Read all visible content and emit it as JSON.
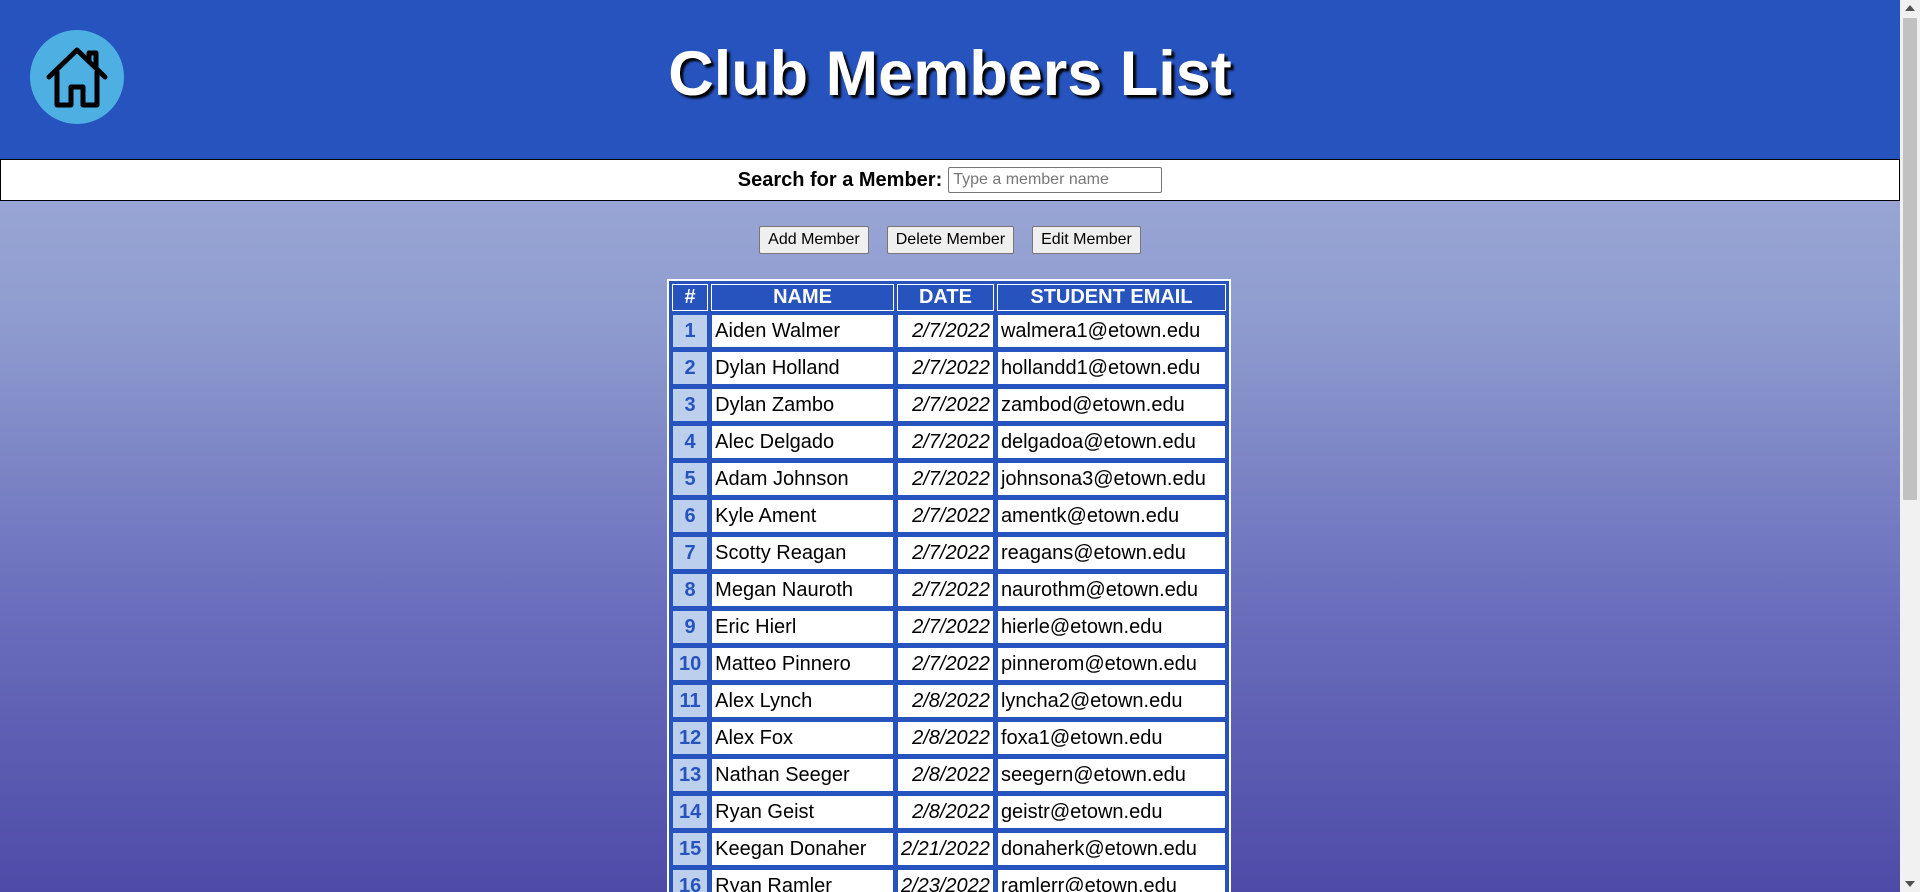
{
  "header": {
    "title": "Club Members List",
    "home_icon": "home-icon",
    "colors": {
      "header_bg": "#2653be",
      "home_button": "#4dafe2",
      "number_cell": "#bcd0ee"
    }
  },
  "search": {
    "label": "Search for a Member:",
    "placeholder": "Type a member name",
    "value": ""
  },
  "actions": {
    "add_label": "Add Member",
    "delete_label": "Delete Member",
    "edit_label": "Edit Member"
  },
  "table": {
    "headers": [
      "#",
      "NAME",
      "DATE",
      "STUDENT EMAIL"
    ],
    "rows": [
      {
        "num": "1",
        "name": "Aiden Walmer",
        "date": "2/7/2022",
        "email": "walmera1@etown.edu"
      },
      {
        "num": "2",
        "name": "Dylan Holland",
        "date": "2/7/2022",
        "email": "hollandd1@etown.edu"
      },
      {
        "num": "3",
        "name": "Dylan Zambo",
        "date": "2/7/2022",
        "email": "zambod@etown.edu"
      },
      {
        "num": "4",
        "name": "Alec Delgado",
        "date": "2/7/2022",
        "email": "delgadoa@etown.edu"
      },
      {
        "num": "5",
        "name": "Adam Johnson",
        "date": "2/7/2022",
        "email": "johnsona3@etown.edu"
      },
      {
        "num": "6",
        "name": "Kyle Ament",
        "date": "2/7/2022",
        "email": "amentk@etown.edu"
      },
      {
        "num": "7",
        "name": "Scotty Reagan",
        "date": "2/7/2022",
        "email": "reagans@etown.edu"
      },
      {
        "num": "8",
        "name": "Megan Nauroth",
        "date": "2/7/2022",
        "email": "naurothm@etown.edu"
      },
      {
        "num": "9",
        "name": "Eric Hierl",
        "date": "2/7/2022",
        "email": "hierle@etown.edu"
      },
      {
        "num": "10",
        "name": "Matteo Pinnero",
        "date": "2/7/2022",
        "email": "pinnerom@etown.edu"
      },
      {
        "num": "11",
        "name": "Alex Lynch",
        "date": "2/8/2022",
        "email": "lyncha2@etown.edu"
      },
      {
        "num": "12",
        "name": "Alex Fox",
        "date": "2/8/2022",
        "email": "foxa1@etown.edu"
      },
      {
        "num": "13",
        "name": "Nathan Seeger",
        "date": "2/8/2022",
        "email": "seegern@etown.edu"
      },
      {
        "num": "14",
        "name": "Ryan Geist",
        "date": "2/8/2022",
        "email": "geistr@etown.edu"
      },
      {
        "num": "15",
        "name": "Keegan Donaher",
        "date": "2/21/2022",
        "email": "donaherk@etown.edu"
      },
      {
        "num": "16",
        "name": "Ryan Ramler",
        "date": "2/23/2022",
        "email": "ramlerr@etown.edu"
      }
    ]
  }
}
